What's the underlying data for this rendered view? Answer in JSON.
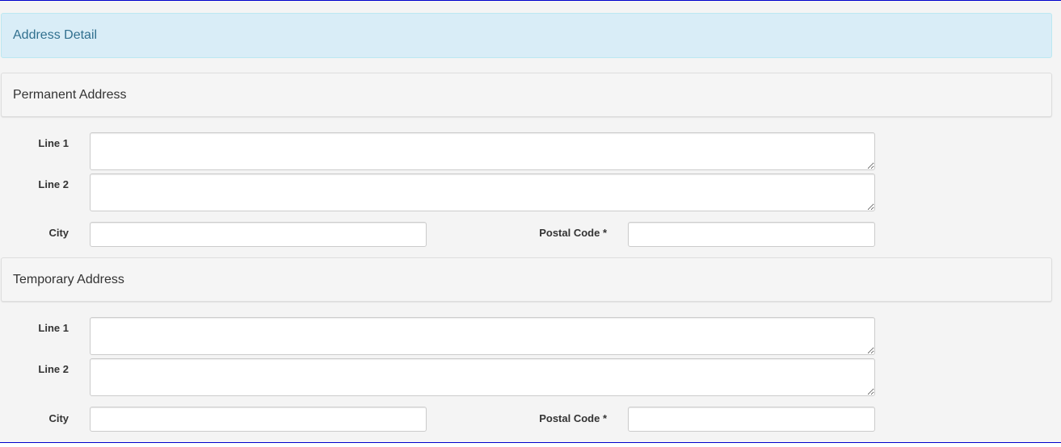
{
  "header": {
    "title": "Address Detail"
  },
  "permanent": {
    "title": "Permanent Address",
    "line1_label": "Line 1",
    "line1_value": "",
    "line2_label": "Line 2",
    "line2_value": "",
    "city_label": "City",
    "city_value": "",
    "postal_label": "Postal Code *",
    "postal_value": ""
  },
  "temporary": {
    "title": "Temporary Address",
    "line1_label": "Line 1",
    "line1_value": "",
    "line2_label": "Line 2",
    "line2_value": "",
    "city_label": "City",
    "city_value": "",
    "postal_label": "Postal Code *",
    "postal_value": ""
  }
}
